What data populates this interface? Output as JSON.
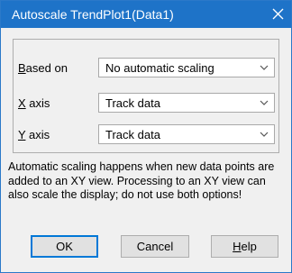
{
  "window": {
    "title": "Autoscale TrendPlot1(Data1)",
    "close_glyph": "✕"
  },
  "form": {
    "based_on": {
      "label_mnemonic": "B",
      "label_rest": "ased on",
      "value": "No automatic scaling"
    },
    "x_axis": {
      "label_mnemonic": "X",
      "label_rest": " axis",
      "value": "Track data"
    },
    "y_axis": {
      "label_mnemonic": "Y",
      "label_rest": " axis",
      "value": "Track data"
    }
  },
  "description": "Automatic scaling happens when new data points are added to an XY view. Processing to an XY view can also scale the display; do not use both options!",
  "buttons": {
    "ok": "OK",
    "cancel": "Cancel",
    "help_mnemonic": "H",
    "help_rest": "elp"
  },
  "colors": {
    "titlebar": "#1e73c8",
    "dialog_bg": "#f0f0f0",
    "default_button_border": "#0078d7"
  },
  "icons": {
    "close": "close-icon",
    "dropdown": "chevron-down-icon"
  }
}
